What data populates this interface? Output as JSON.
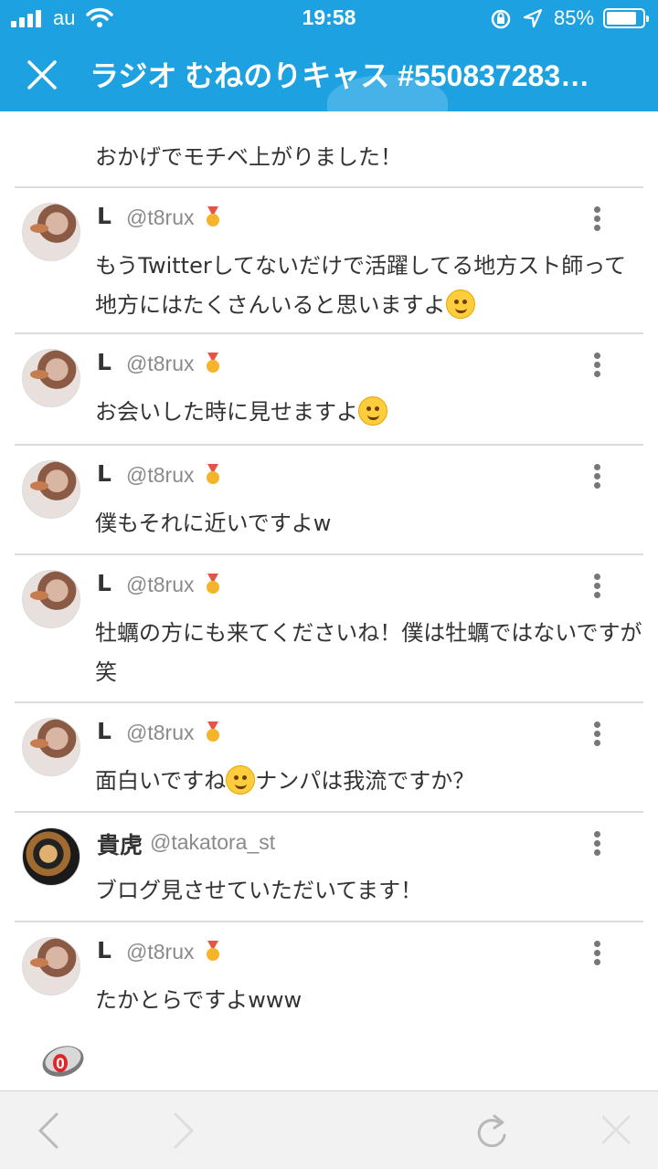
{
  "status_bar": {
    "carrier": "au",
    "time": "19:58",
    "battery_percent": "85%",
    "battery_level": 0.85
  },
  "header": {
    "title": "ラジオ むねのりキャス #550837283…"
  },
  "first_message": "おかげでモチベ上がりました！",
  "comments": [
    {
      "name": "L",
      "handle": "@t8rux",
      "avatar": "girl",
      "text": "もうTwitterしてないだけで活躍してる地方スト師って地方にはたくさんいると思いますよ",
      "emoji": "wink-emoji"
    },
    {
      "name": "L",
      "handle": "@t8rux",
      "avatar": "girl",
      "text": "お会いした時に見せますよ",
      "emoji": "tears-of-joy-emoji"
    },
    {
      "name": "L",
      "handle": "@t8rux",
      "avatar": "girl",
      "text": "僕もそれに近いですよw"
    },
    {
      "name": "L",
      "handle": "@t8rux",
      "avatar": "girl",
      "text": "牡蠣の方にも来てくださいね！僕は牡蠣ではないですが笑"
    },
    {
      "name": "L",
      "handle": "@t8rux",
      "avatar": "girl",
      "text_before": "面白いですね",
      "text_after": "ナンパは我流ですか？",
      "emoji": "smile-emoji"
    },
    {
      "name": "貴虎",
      "handle": "@takatora_st",
      "avatar": "tiger",
      "text": "ブログ見させていただいてます！"
    },
    {
      "name": "L",
      "handle": "@t8rux",
      "avatar": "girl",
      "text": "たかとらですよwww"
    }
  ],
  "floating_badge": {
    "count": "0"
  },
  "icons": {
    "signal": "signal-bars-icon",
    "wifi": "wifi-icon",
    "rotation_lock": "rotation-lock-icon",
    "location": "location-arrow-icon",
    "close": "close-icon",
    "medal": "medal-icon",
    "more": "more-vertical-icon",
    "back": "chevron-left-icon",
    "forward": "chevron-right-icon",
    "reload": "reload-icon",
    "stop": "close-icon"
  },
  "colors": {
    "header_bg": "#1da1e0",
    "text": "#333333",
    "handle": "#8a8a8a",
    "divider": "#dcdcdc",
    "toolbar_bg": "#f2f2f2",
    "badge_red": "#e0262b"
  }
}
